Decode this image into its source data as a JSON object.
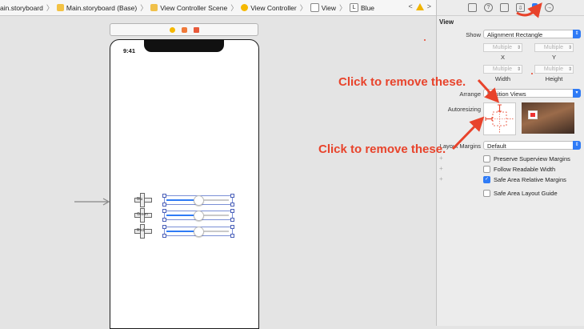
{
  "breadcrumb": {
    "items": [
      {
        "label": "ain.storyboard",
        "icon": "storyboard-file-icon"
      },
      {
        "label": "Main.storyboard (Base)",
        "icon": "storyboard-file-icon"
      },
      {
        "label": "View Controller Scene",
        "icon": "scene-icon"
      },
      {
        "label": "View Controller",
        "icon": "view-controller-icon"
      },
      {
        "label": "View",
        "icon": "view-icon"
      },
      {
        "label": "Blue",
        "icon": "label-icon",
        "badge": "L"
      }
    ]
  },
  "phone": {
    "clock": "9:41",
    "rows": [
      {
        "control_label": "Blu"
      },
      {
        "control_label": "Green"
      },
      {
        "control_label": "Red"
      }
    ]
  },
  "inspector": {
    "section_title": "View",
    "show_label": "Show",
    "show_value": "Alignment Rectangle",
    "multiple": "Multiple",
    "x_label": "X",
    "y_label": "Y",
    "width_label": "Width",
    "height_label": "Height",
    "arrange_label": "Arrange",
    "arrange_value": "Position Views",
    "autoresizing_label": "Autoresizing",
    "layout_margins_label": "Layout Margins",
    "layout_margins_value": "Default",
    "checkboxes": [
      {
        "label": "Preserve Superview Margins",
        "checked": false
      },
      {
        "label": "Follow Readable Width",
        "checked": false
      },
      {
        "label": "Safe Area Relative Margins",
        "checked": true
      },
      {
        "label": "Safe Area Layout Guide",
        "checked": false
      }
    ]
  },
  "annotations": {
    "top": "Click to remove these.",
    "bottom": "Click to remove these."
  },
  "colors": {
    "accent": "#2f7bf6",
    "annotation": "#e8432b"
  }
}
